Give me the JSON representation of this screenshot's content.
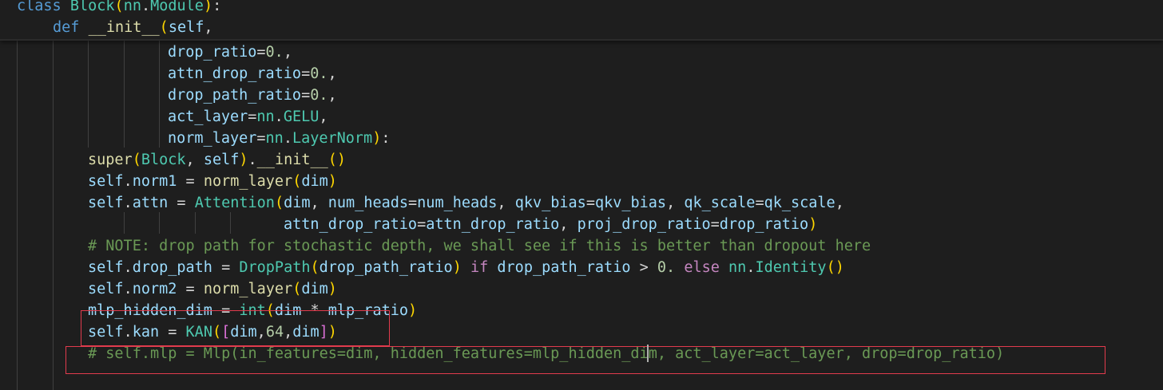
{
  "sticky": {
    "line1": {
      "kw": "class",
      "name": "Block",
      "base_mod": "nn",
      "base_cls": "Module",
      "tail": "):"
    },
    "line2": {
      "kw": "def",
      "fn": "__init__",
      "arg": "self"
    }
  },
  "params": [
    {
      "name": "drop_ratio",
      "value": "0."
    },
    {
      "name": "attn_drop_ratio",
      "value": "0."
    },
    {
      "name": "drop_path_ratio",
      "value": "0."
    },
    {
      "name": "act_layer",
      "mod": "nn",
      "cls": "GELU"
    },
    {
      "name": "norm_layer",
      "mod": "nn",
      "cls": "LayerNorm"
    }
  ],
  "code": {
    "super_fn": "super",
    "super_cls": "Block",
    "self": "self",
    "init_fn": "__init__",
    "norm1": "norm1",
    "norm2": "norm2",
    "norm_layer": "norm_layer",
    "dim": "dim",
    "attn": "attn",
    "attention_cls": "Attention",
    "num_heads": "num_heads",
    "qkv_bias": "qkv_bias",
    "qk_scale": "qk_scale",
    "attn_drop_ratio": "attn_drop_ratio",
    "proj_drop_ratio": "proj_drop_ratio",
    "drop_ratio": "drop_ratio",
    "comment": "# NOTE: drop path for stochastic depth, we shall see if this is better than dropout here",
    "drop_path": "drop_path",
    "droppath_cls": "DropPath",
    "drop_path_ratio": "drop_path_ratio",
    "if_kw": "if",
    "else_kw": "else",
    "zero": "0.",
    "nn": "nn",
    "identity_cls": "Identity",
    "mlp_hidden_dim": "mlp_hidden_dim",
    "int_fn": "int",
    "mlp_ratio": "mlp_ratio",
    "kan": "kan",
    "kan_cls": "KAN",
    "kan_mid": "64",
    "commented_mlp": "# self.mlp = Mlp(in_features=dim, hidden_features=mlp_hidden_dim, act_layer=act_layer, drop=drop_ratio)"
  },
  "colors": {
    "background": "#1e1e1e",
    "keyword": "#569cd6",
    "class": "#4ec9b0",
    "function": "#dcdcaa",
    "variable": "#9cdcfe",
    "number": "#b5cea8",
    "comment": "#6a9955",
    "highlight_box": "#e23b4d"
  }
}
